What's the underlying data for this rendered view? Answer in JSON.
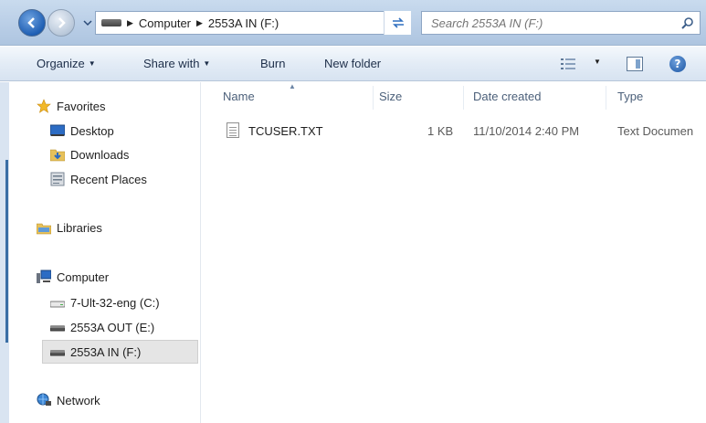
{
  "address_bar": {
    "breadcrumbs": [
      "Computer",
      "2553A IN (F:)"
    ],
    "search_placeholder": "Search 2553A IN (F:)"
  },
  "toolbar": {
    "organize": "Organize",
    "share_with": "Share with",
    "burn": "Burn",
    "new_folder": "New folder"
  },
  "nav": {
    "favorites": "Favorites",
    "desktop": "Desktop",
    "downloads": "Downloads",
    "recent_places": "Recent Places",
    "libraries": "Libraries",
    "computer": "Computer",
    "drive_c": "7-Ult-32-eng (C:)",
    "drive_e": "2553A OUT (E:)",
    "drive_f": "2553A IN (F:)",
    "network": "Network"
  },
  "columns": {
    "name": "Name",
    "size": "Size",
    "date_created": "Date created",
    "type": "Type"
  },
  "files": [
    {
      "name": "TCUSER.TXT",
      "size": "1 KB",
      "date_created": "11/10/2014 2:40 PM",
      "type": "Text Documen"
    }
  ],
  "colors": {
    "accent_blue": "#1f5fb4",
    "toolbar_text": "#1e2f4a",
    "selection_gray": "#e5e5e5"
  }
}
